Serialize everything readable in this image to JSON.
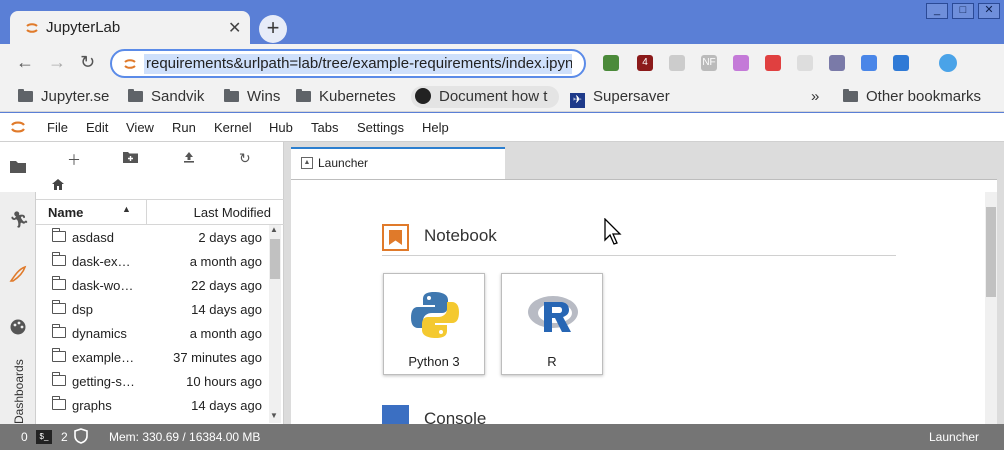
{
  "browser": {
    "tab_title": "JupyterLab",
    "tab_close": "✕",
    "new_tab": "+",
    "url": "requirements&urlpath=lab/tree/example-requirements/index.ipynb",
    "extensions": [
      {
        "name": "ext-green-icon",
        "color": "#4b8a3a",
        "text": ""
      },
      {
        "name": "ublock-icon",
        "color": "#8b1a1a",
        "text": "4"
      },
      {
        "name": "ext-hexagon-icon",
        "color": "#cccccc",
        "text": ""
      },
      {
        "name": "ext-nf-icon",
        "color": "#bbbbbb",
        "text": "NF"
      },
      {
        "name": "ext-flower-icon",
        "color": "#c47ad8",
        "text": ""
      },
      {
        "name": "ext-red-icon",
        "color": "#e04040",
        "text": ""
      },
      {
        "name": "ext-box-icon",
        "color": "#dddddd",
        "text": ""
      },
      {
        "name": "ext-circle-icon",
        "color": "#7a7aa8",
        "text": ""
      },
      {
        "name": "translate-icon",
        "color": "#4a86e8",
        "text": ""
      },
      {
        "name": "ext-window-icon",
        "color": "#2f7ad6",
        "text": ""
      },
      {
        "name": "profile-icon",
        "color": "#4aa3e8",
        "text": ""
      }
    ]
  },
  "bookmarks": {
    "items": [
      "Jupyter.se",
      "Sandvik",
      "Wins",
      "Kubernetes"
    ],
    "github": "Document how t",
    "supersaver": "Supersaver",
    "more": "»",
    "other": "Other bookmarks"
  },
  "menu": [
    "File",
    "Edit",
    "View",
    "Run",
    "Kernel",
    "Hub",
    "Tabs",
    "Settings",
    "Help"
  ],
  "sidebar_label": "Dashboards",
  "filebrowser": {
    "col_name": "Name",
    "col_modified": "Last Modified",
    "rows": [
      {
        "name": "asdasd",
        "modified": "2 days ago"
      },
      {
        "name": "dask-ex…",
        "modified": "a month ago"
      },
      {
        "name": "dask-wo…",
        "modified": "22 days ago"
      },
      {
        "name": "dsp",
        "modified": "14 days ago"
      },
      {
        "name": "dynamics",
        "modified": "a month ago"
      },
      {
        "name": "example…",
        "modified": "37 minutes ago"
      },
      {
        "name": "getting-s…",
        "modified": "10 hours ago"
      },
      {
        "name": "graphs",
        "modified": "14 days ago"
      }
    ]
  },
  "launcher": {
    "tab_label": "Launcher",
    "notebook_section": "Notebook",
    "kernels": [
      "Python 3",
      "R"
    ],
    "console_section": "Console"
  },
  "status": {
    "count0": "0",
    "count1": "2",
    "mem": "Mem: 330.69 / 16384.00 MB",
    "right": "Launcher"
  },
  "colors": {
    "accent": "#2c7fcf",
    "chrome": "#5a7fd6",
    "jupyter_orange": "#e07a2a"
  }
}
